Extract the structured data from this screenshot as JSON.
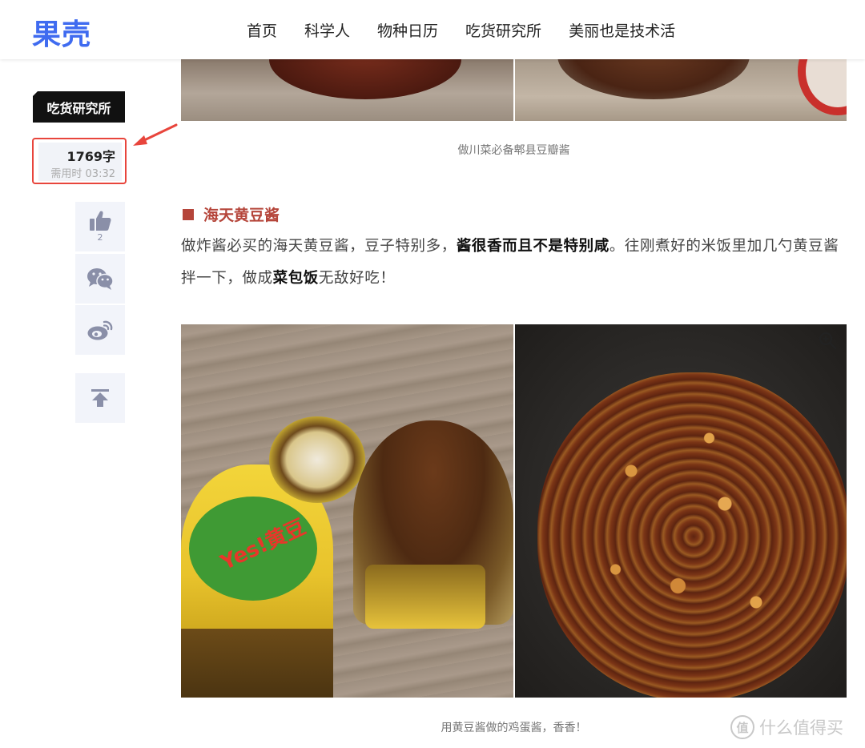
{
  "header": {
    "logo": "果壳",
    "nav": [
      "首页",
      "科学人",
      "物种日历",
      "吃货研究所",
      "美丽也是技术活"
    ]
  },
  "sidebar": {
    "category_tag": "吃货研究所",
    "word_count": "1769字",
    "read_time": "需用时 03:32",
    "like_count": "2"
  },
  "article": {
    "top_caption": "做川菜必备郫县豆瓣酱",
    "heading": "海天黄豆酱",
    "para_1": "做炸酱必买的海天黄豆酱，豆子特别多，",
    "para_bold_1": "酱很香而且不是特别咸",
    "para_2": "。往刚煮好的米饭里加几勺黄豆酱拌一下，做成",
    "para_bold_2": "菜包饭",
    "para_3": "无敌好吃！",
    "jar_label": "Yes!黄豆",
    "bottom_caption": "用黄豆酱做的鸡蛋酱，香香！"
  },
  "watermark": {
    "badge": "值",
    "text": "什么值得买"
  },
  "colors": {
    "logo_blue": "#3f6bf0",
    "heading_red": "#b5453a",
    "highlight_red": "#e8453c",
    "side_button_bg": "#f2f4fa",
    "side_icon": "#8a8fa8"
  }
}
